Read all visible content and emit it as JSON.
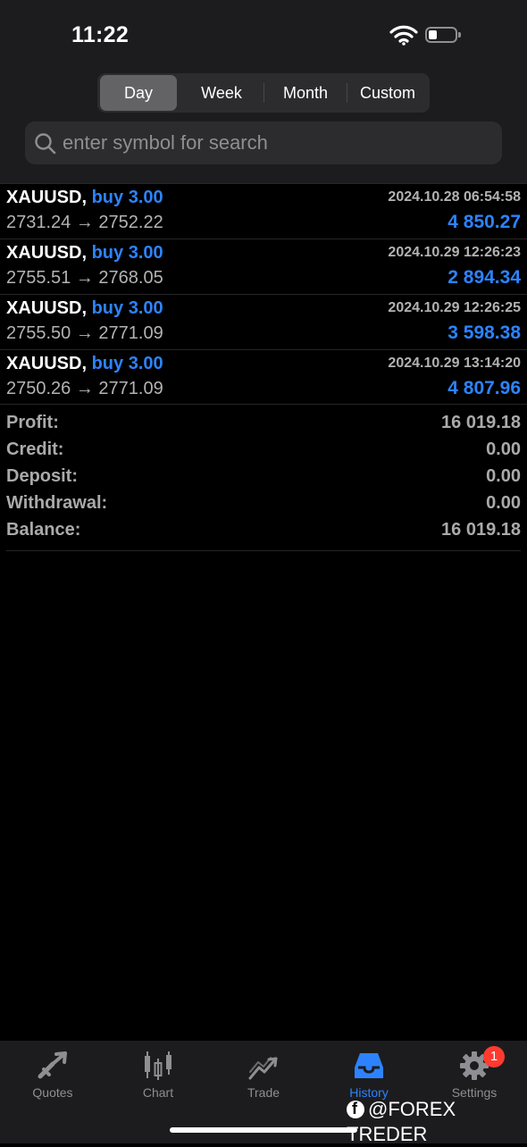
{
  "status": {
    "time": "11:22"
  },
  "tabs": [
    "Day",
    "Week",
    "Month",
    "Custom"
  ],
  "search": {
    "placeholder": "enter symbol for search",
    "value": ""
  },
  "deals": [
    {
      "symbol": "XAUUSD,",
      "side": "buy 3.00",
      "time": "2024.10.28 06:54:58",
      "prices": "2731.24 → 2752.22",
      "profit": "4 850.27"
    },
    {
      "symbol": "XAUUSD,",
      "side": "buy 3.00",
      "time": "2024.10.29 12:26:23",
      "prices": "2755.51 → 2768.05",
      "profit": "2 894.34"
    },
    {
      "symbol": "XAUUSD,",
      "side": "buy 3.00",
      "time": "2024.10.29 12:26:25",
      "prices": "2755.50 → 2771.09",
      "profit": "3 598.38"
    },
    {
      "symbol": "XAUUSD,",
      "side": "buy 3.00",
      "time": "2024.10.29 13:14:20",
      "prices": "2750.26 → 2771.09",
      "profit": "4 807.96"
    }
  ],
  "summary": [
    {
      "label": "Profit:",
      "value": "16 019.18"
    },
    {
      "label": "Credit:",
      "value": "0.00"
    },
    {
      "label": "Deposit:",
      "value": "0.00"
    },
    {
      "label": "Withdrawal:",
      "value": "0.00"
    },
    {
      "label": "Balance:",
      "value": "16 019.18"
    }
  ],
  "tabbar": [
    {
      "label": "Quotes",
      "icon": "quotes-icon"
    },
    {
      "label": "Chart",
      "icon": "candlestick-chart-icon"
    },
    {
      "label": "Trade",
      "icon": "trade-trend-icon"
    },
    {
      "label": "History",
      "icon": "inbox-history-icon",
      "active": true
    },
    {
      "label": "Settings",
      "icon": "gear-icon",
      "badge": "1"
    }
  ],
  "watermark": "@FOREX TREDER",
  "colors": {
    "accent": "#2d83ff",
    "badge": "#ff3b30",
    "background": "#000000",
    "panel": "#1c1c1e"
  }
}
